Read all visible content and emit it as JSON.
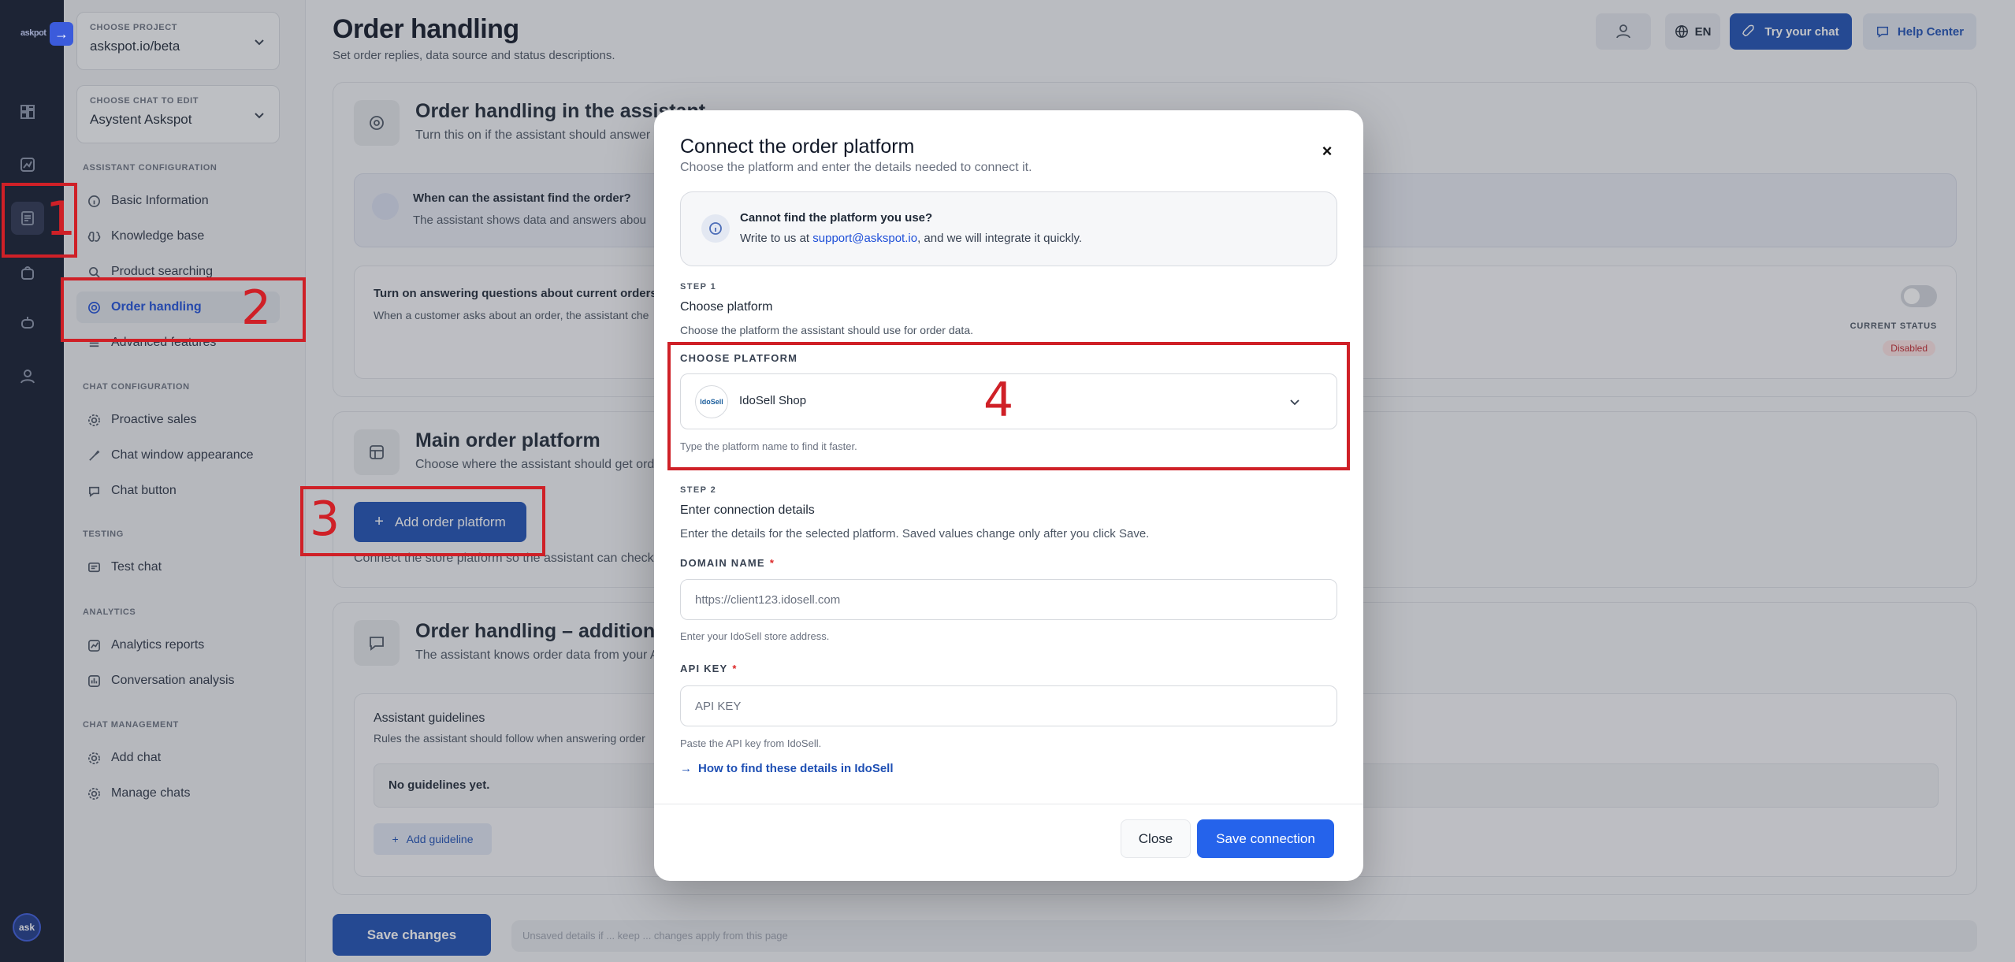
{
  "rail": {
    "logo": "askpot",
    "collapse_glyph": "→",
    "avatar_label": "ask",
    "icons": [
      "dashboard-icon",
      "chart-icon",
      "document-icon",
      "bag-icon",
      "bot-icon",
      "user-icon"
    ]
  },
  "sidebar": {
    "project": {
      "caption": "CHOOSE PROJECT",
      "value": "askspot.io/beta"
    },
    "chat": {
      "caption": "CHOOSE CHAT TO EDIT",
      "value": "Asystent Askspot"
    },
    "sections": [
      {
        "title": "ASSISTANT CONFIGURATION",
        "items": [
          "Basic Information",
          "Knowledge base",
          "Product searching",
          "Order handling",
          "Advanced features"
        ]
      },
      {
        "title": "CHAT CONFIGURATION",
        "items": [
          "Proactive sales",
          "Chat window appearance",
          "Chat button"
        ]
      },
      {
        "title": "TESTING",
        "items": [
          "Test chat"
        ]
      },
      {
        "title": "ANALYTICS",
        "items": [
          "Analytics reports",
          "Conversation analysis"
        ]
      },
      {
        "title": "CHAT MANAGEMENT",
        "items": [
          "Add chat",
          "Manage chats"
        ]
      }
    ],
    "active_item": "Order handling"
  },
  "header": {
    "title": "Order handling",
    "subtitle": "Set order replies, data source and status descriptions.",
    "language": "EN",
    "try_chat": "Try your chat",
    "help_center": "Help Center"
  },
  "cards": {
    "assistant": {
      "title": "Order handling in the assistant",
      "subtitle": "Turn this on if the assistant should answer q",
      "when_title": "When can the assistant find the order?",
      "when_desc": "The assistant shows data and answers abou",
      "toggle_title": "Turn on answering questions about current orders",
      "toggle_desc": "When a customer asks about an order, the assistant che",
      "status_caption": "CURRENT STATUS",
      "status_value": "Disabled"
    },
    "platform": {
      "title": "Main order platform",
      "subtitle": "Choose where the assistant should get orde",
      "add_button": "Add order platform",
      "hint": "Connect the store platform so the assistant can check o"
    },
    "additional": {
      "title": "Order handling – additional in",
      "subtitle": "The assistant knows order data from your A",
      "guidelines_title": "Assistant guidelines",
      "guidelines_desc": "Rules the assistant should follow when answering order",
      "empty": "No guidelines yet.",
      "add_guideline": "Add guideline"
    }
  },
  "footer": {
    "save_changes": "Save changes",
    "note": "Unsaved details if ... keep ... changes apply from this page"
  },
  "modal": {
    "title": "Connect the order platform",
    "subtitle": "Choose the platform and enter the details needed to connect it.",
    "info_title": "Cannot find the platform you use?",
    "info_prefix": "Write to us at ",
    "info_email": "support@askspot.io",
    "info_suffix": ", and we will integrate it quickly.",
    "step1": {
      "label": "STEP 1",
      "heading": "Choose platform",
      "desc": "Choose the platform the assistant should use for order data.",
      "field_label": "CHOOSE PLATFORM",
      "selected_platform": "IdoSell Shop",
      "platform_logo_text": "IdoSell",
      "hint": "Type the platform name to find it faster."
    },
    "step2": {
      "label": "STEP 2",
      "heading": "Enter connection details",
      "desc": "Enter the details for the selected platform. Saved values change only after you click Save.",
      "domain_label": "DOMAIN NAME",
      "domain_placeholder": "https://client123.idosell.com",
      "domain_hint": "Enter your IdoSell store address.",
      "api_label": "API KEY",
      "api_placeholder": "API KEY",
      "api_hint": "Paste the API key from IdoSell.",
      "help_link": "How to find these details in IdoSell"
    },
    "required_mark": "*",
    "close_button": "Close",
    "save_button": "Save connection"
  },
  "annotations": [
    "1",
    "2",
    "3",
    "4"
  ],
  "colors": {
    "accent": "#1e4fd8",
    "annotation": "#cf2027",
    "rail": "#121a2e",
    "danger": "#dc2626"
  }
}
